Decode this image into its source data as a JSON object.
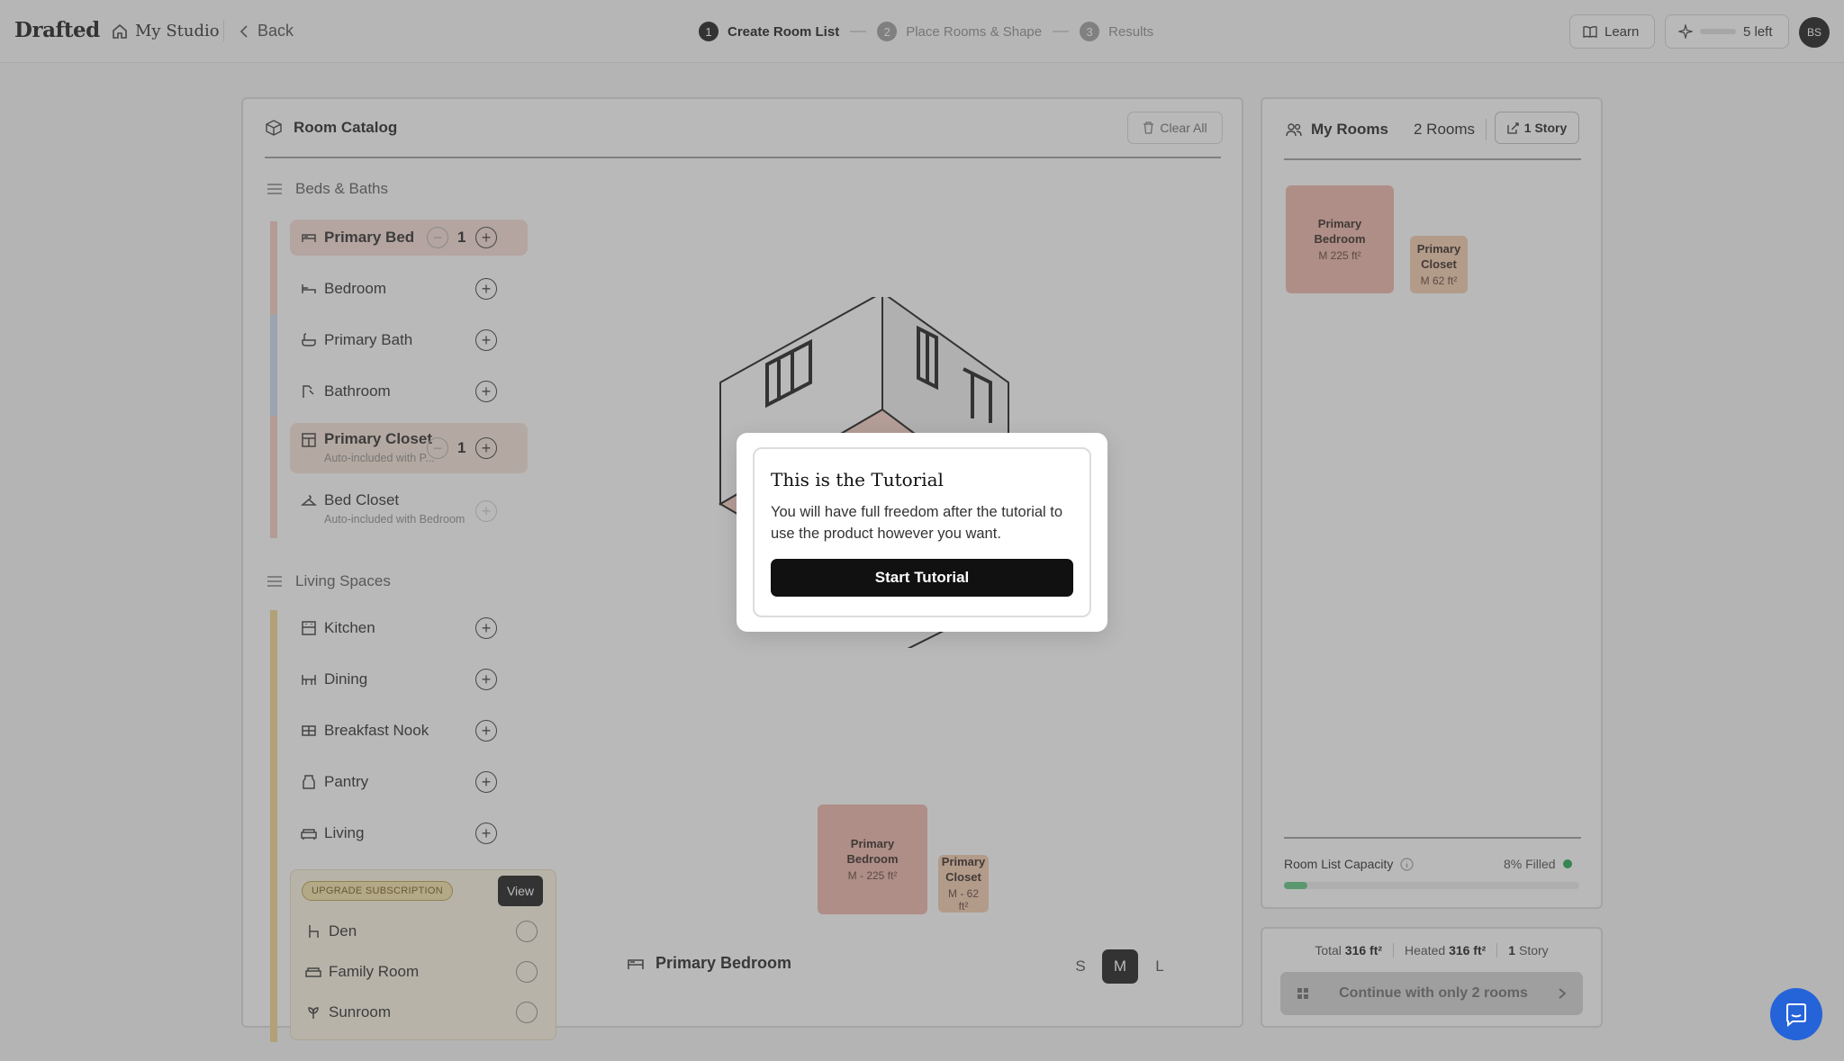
{
  "header": {
    "logo": "Drafted",
    "studio_label": "My Studio",
    "back_label": "Back",
    "steps": [
      {
        "num": "1",
        "label": "Create Room List"
      },
      {
        "num": "2",
        "label": "Place Rooms & Shape"
      },
      {
        "num": "3",
        "label": "Results"
      }
    ],
    "learn_label": "Learn",
    "credits_label": "5 left",
    "avatar_initials": "BS"
  },
  "catalog": {
    "title": "Room Catalog",
    "clear_label": "Clear All",
    "groups": [
      {
        "title": "Beds & Baths",
        "rooms": [
          {
            "name": "Primary Bed",
            "qty": "1"
          },
          {
            "name": "Bedroom"
          },
          {
            "name": "Primary Bath"
          },
          {
            "name": "Bathroom"
          },
          {
            "name": "Primary Closet",
            "qty": "1",
            "sub": "Auto-included with P..."
          },
          {
            "name": "Bed Closet",
            "sub": "Auto-included with Bedroom"
          }
        ]
      },
      {
        "title": "Living Spaces",
        "rooms": [
          {
            "name": "Kitchen"
          },
          {
            "name": "Dining"
          },
          {
            "name": "Breakfast Nook"
          },
          {
            "name": "Pantry"
          },
          {
            "name": "Living"
          }
        ]
      }
    ],
    "upgrade": {
      "badge": "UPGRADE SUBSCRIPTION",
      "view_label": "View",
      "rooms": [
        "Den",
        "Family Room",
        "Sunroom"
      ]
    },
    "preview": {
      "room_name": "Primary Bedroom",
      "tiles": [
        {
          "name": "Primary Bedroom",
          "size": "M - 225 ft²"
        },
        {
          "name": "Primary Closet",
          "size": "M - 62 ft²"
        }
      ],
      "sizes": [
        "S",
        "M",
        "L"
      ],
      "selected_size": "M"
    }
  },
  "my_rooms": {
    "title": "My Rooms",
    "count_label": "2 Rooms",
    "story_label": "1 Story",
    "tiles": [
      {
        "name": "Primary Bedroom",
        "size": "M 225 ft²"
      },
      {
        "name": "Primary Closet",
        "size": "M 62 ft²"
      }
    ],
    "capacity_label": "Room List Capacity",
    "capacity_filled": "8% Filled",
    "capacity_fraction": 0.08
  },
  "summary": {
    "total_label": "Total",
    "total_value": "316 ft²",
    "heated_label": "Heated",
    "heated_value": "316 ft²",
    "stories_value": "1",
    "stories_label": "Story",
    "continue_label": "Continue with only 2 rooms"
  },
  "modal": {
    "title": "This is the Tutorial",
    "body": "You will have full freedom after the tutorial to use the product however you want.",
    "button_label": "Start Tutorial"
  },
  "colors": {
    "bed_bath_accent": "#f2cbbf",
    "bath_accent": "#c9d9ee",
    "living_accent": "#f2d48a",
    "primary_tile": "#ebb3a6",
    "closet_tile": "#f3c9a9",
    "chat_button": "#2563d9"
  }
}
